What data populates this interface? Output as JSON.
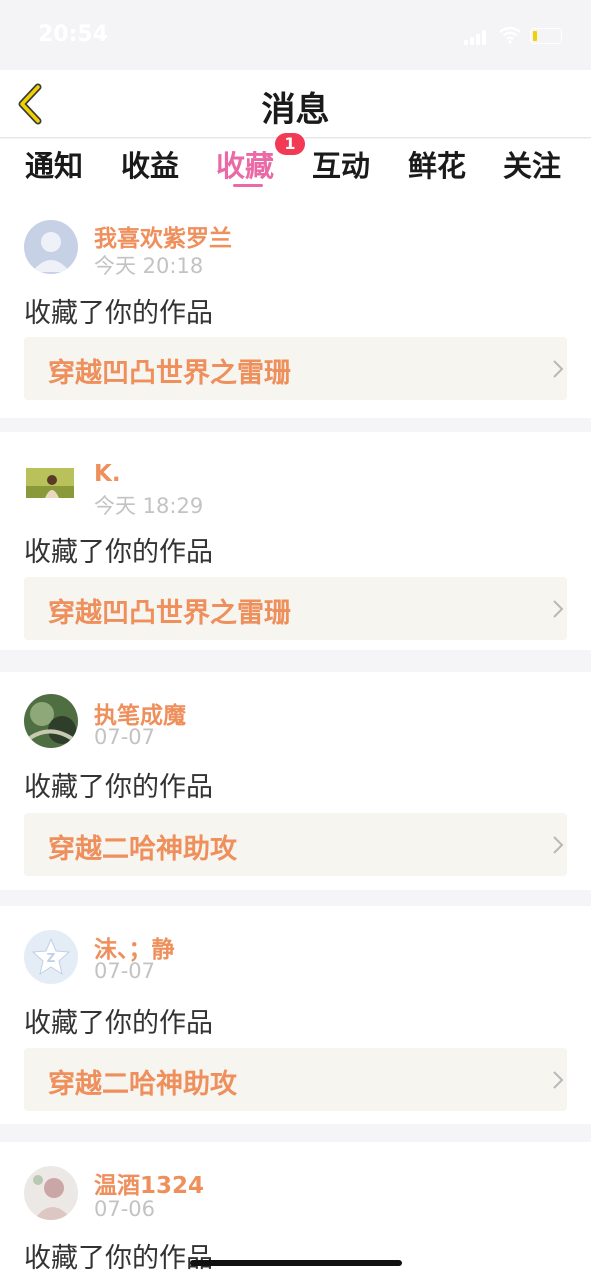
{
  "status_bar": {
    "time": "20:54"
  },
  "header": {
    "title": "消息",
    "back_icon": "chevron-left-icon",
    "back_color": "#f0d200"
  },
  "tabs": [
    {
      "label": "通知"
    },
    {
      "label": "收益"
    },
    {
      "label": "收藏",
      "active": true,
      "badge": "1"
    },
    {
      "label": "互动"
    },
    {
      "label": "鲜花"
    },
    {
      "label": "关注"
    }
  ],
  "colors": {
    "accent": "#ea6aa7",
    "name": "#ee8f5c",
    "badge": "#f23a54"
  },
  "notifications": [
    {
      "user": "我喜欢紫罗兰",
      "time": "今天 20:18",
      "action": "收藏了你的作品",
      "work": "穿越凹凸世界之雷珊",
      "avatar_icon": "default-avatar-icon"
    },
    {
      "user": "K.",
      "time": "今天 18:29",
      "action": "收藏了你的作品",
      "work": "穿越凹凸世界之雷珊",
      "avatar_icon": "photo-avatar-icon"
    },
    {
      "user": "执笔成魔",
      "time": "07-07",
      "action": "收藏了你的作品",
      "work": "穿越二哈神助攻",
      "avatar_icon": "photo-avatar-icon"
    },
    {
      "user": "沫、；静",
      "time": "07-07",
      "action": "收藏了你的作品",
      "work": "穿越二哈神助攻",
      "avatar_icon": "qzone-avatar-icon"
    },
    {
      "user": "温酒1324",
      "time": "07-06",
      "action": "收藏了你的作品",
      "work": "",
      "avatar_icon": "photo-avatar-icon"
    }
  ]
}
